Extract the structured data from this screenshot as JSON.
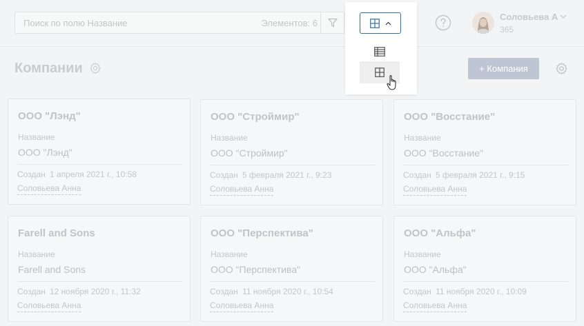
{
  "search": {
    "placeholder": "Поиск по полю Название",
    "count_label": "Элементов: 6"
  },
  "user": {
    "name": "Соловьева А",
    "sub": "365"
  },
  "page": {
    "title": "Компании",
    "add_button": "+ Компания"
  },
  "view_menu": {
    "items": [
      "table-view",
      "grid-view"
    ],
    "selected": "grid-view"
  },
  "card_labels": {
    "field": "Название",
    "created": "Создан"
  },
  "cards": [
    {
      "title": "ООО \"Лэнд\"",
      "name": "ООО \"Лэнд\"",
      "created": "1 апреля 2021 г., 10:58",
      "author": "Соловьева Анна"
    },
    {
      "title": "ООО \"Строймир\"",
      "name": "ООО \"Строймир\"",
      "created": "5 февраля 2021 г., 9:23",
      "author": "Соловьева Анна"
    },
    {
      "title": "ООО \"Восстание\"",
      "name": "ООО \"Восстание\"",
      "created": "5 февраля 2021 г., 9:15",
      "author": "Соловьева Анна"
    },
    {
      "title": "Farell and Sons",
      "name": "Farell and Sons",
      "created": "12 ноября 2020 г., 11:32",
      "author": "Соловьева Анна"
    },
    {
      "title": "ООО \"Перспектива\"",
      "name": "ООО \"Перспектива\"",
      "created": "11 ноября 2020 г., 10:54",
      "author": "Соловьева Анна"
    },
    {
      "title": "ООО \"Альфа\"",
      "name": "ООО \"Альфа\"",
      "created": "11 ноября 2020 г., 10:09",
      "author": "Соловьева Анна"
    }
  ],
  "colors": {
    "accent": "#2d6fa6",
    "add_button_bg": "#bdc6d2",
    "page_bg": "#f3f4f5"
  }
}
